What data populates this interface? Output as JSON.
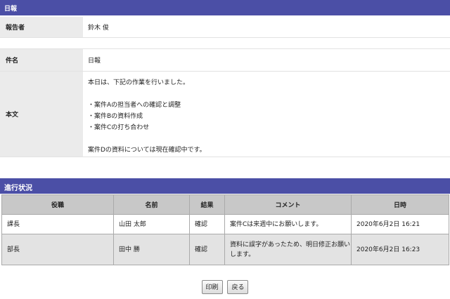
{
  "header": {
    "title": "日報"
  },
  "reporter": {
    "label": "報告者",
    "value": "鈴木 俊"
  },
  "report": {
    "subject_label": "件名",
    "subject_value": "日報",
    "body_label": "本文",
    "body_lines": [
      "本日は、下記の作業を行いました。",
      "",
      "・案件Aの担当者への確認と調整",
      "・案件Bの資料作成",
      "・案件Cの打ち合わせ",
      "",
      "案件Dの資料については現在確認中です。"
    ]
  },
  "progress": {
    "title": "進行状況",
    "columns": [
      "役職",
      "名前",
      "結果",
      "コメント",
      "日時"
    ],
    "rows": [
      {
        "role": "課長",
        "name": "山田 太郎",
        "result": "確認",
        "comment": "案件Cは来週中にお願いします。",
        "datetime": "2020年6月2日 16:21"
      },
      {
        "role": "部長",
        "name": "田中 勝",
        "result": "確認",
        "comment": "資料に誤字があったため、明日修正お願いします。",
        "datetime": "2020年6月2日 16:23"
      }
    ]
  },
  "buttons": {
    "print_label": "印刷",
    "back_label": "戻る"
  }
}
